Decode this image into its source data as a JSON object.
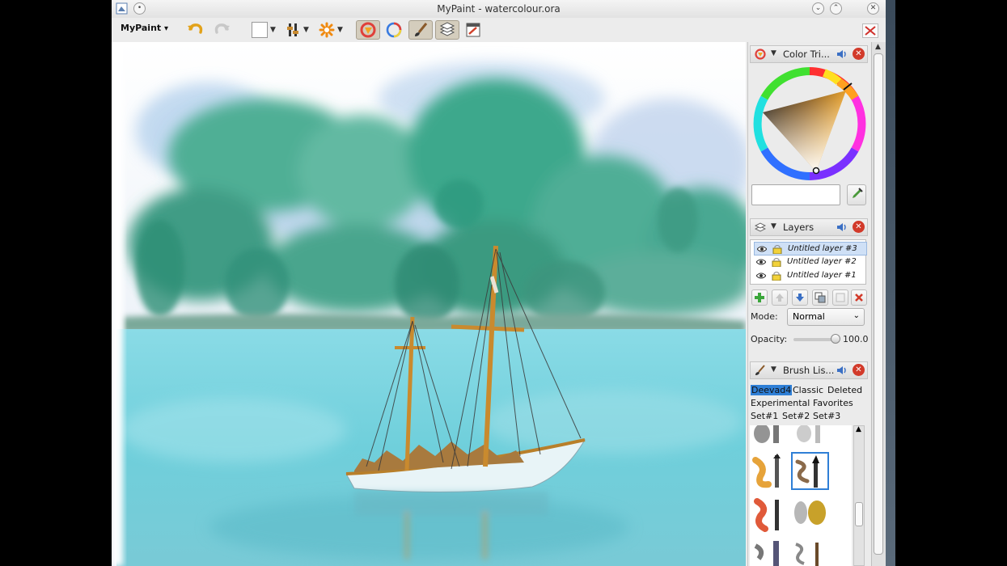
{
  "window": {
    "title": "MyPaint - watercolour.ora"
  },
  "toolbar": {
    "menu_label": "MyPaint",
    "menu_caret": "▾",
    "undo_icon": "undo-icon",
    "redo_icon": "redo-icon"
  },
  "color_panel": {
    "title": "Color Tri...",
    "hex_value": ""
  },
  "layers_panel": {
    "title": "Layers",
    "layers": [
      {
        "name": "Untitled layer #3",
        "selected": true
      },
      {
        "name": "Untitled layer #2",
        "selected": false
      },
      {
        "name": "Untitled layer #1",
        "selected": false
      }
    ],
    "mode_label": "Mode:",
    "mode_value": "Normal",
    "opacity_label": "Opacity:",
    "opacity_value": "100.0",
    "opacity": 100
  },
  "brush_panel": {
    "title": "Brush Lis...",
    "groups_row1": [
      "Deevad4",
      "Classic",
      "Deleted"
    ],
    "groups_row2": [
      "Experimental",
      "Favorites"
    ],
    "groups_row3": [
      "Set#1",
      "Set#2",
      "Set#3"
    ],
    "active_group": "Deevad4"
  },
  "colors": {
    "accent": "#2f7fd6",
    "close_red": "#d23a2a",
    "water": "#7fd3de",
    "trees": "#3ea88c",
    "sail_wood": "#c98a2e"
  }
}
